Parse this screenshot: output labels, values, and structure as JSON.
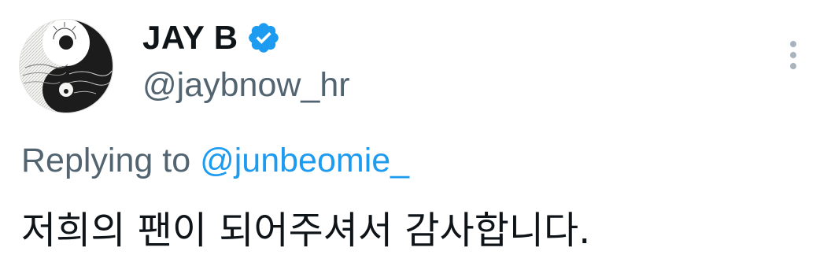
{
  "author": {
    "display_name": "JAY B",
    "handle": "@jaybnow_hr",
    "verified": true,
    "verified_badge_color": "#1d9bf0"
  },
  "reply": {
    "prefix": "Replying to",
    "mention": "@junbeomie_",
    "mention_color": "#1d9bf0"
  },
  "tweet": {
    "text": "저희의 팬이 되어주셔서 감사합니다."
  },
  "icons": {
    "avatar": "yin-yang-landscape-avatar",
    "badge": "verified-badge-icon",
    "menu": "more-options-vertical-dots-icon"
  }
}
